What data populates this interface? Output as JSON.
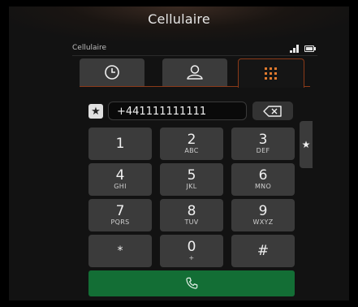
{
  "app": {
    "title": "Cellulaire"
  },
  "status": {
    "carrier": "Cellulaire"
  },
  "tabs": [
    {
      "icon": "clock-icon",
      "name": "recents"
    },
    {
      "icon": "person-icon",
      "name": "contacts"
    },
    {
      "icon": "keypad-grid-icon",
      "name": "keypad",
      "active": true
    }
  ],
  "dialer": {
    "number": "+441111111111",
    "keys": [
      {
        "digit": "1",
        "letters": ""
      },
      {
        "digit": "2",
        "letters": "ABC"
      },
      {
        "digit": "3",
        "letters": "DEF"
      },
      {
        "digit": "4",
        "letters": "GHI"
      },
      {
        "digit": "5",
        "letters": "JKL"
      },
      {
        "digit": "6",
        "letters": "MNO"
      },
      {
        "digit": "7",
        "letters": "PQRS"
      },
      {
        "digit": "8",
        "letters": "TUV"
      },
      {
        "digit": "9",
        "letters": "WXYZ"
      },
      {
        "digit": "*",
        "letters": ""
      },
      {
        "digit": "0",
        "letters": "+"
      },
      {
        "digit": "#",
        "letters": ""
      }
    ]
  },
  "colors": {
    "accent": "#e07a2e",
    "call": "#136e35",
    "key": "#3b3b3b"
  }
}
